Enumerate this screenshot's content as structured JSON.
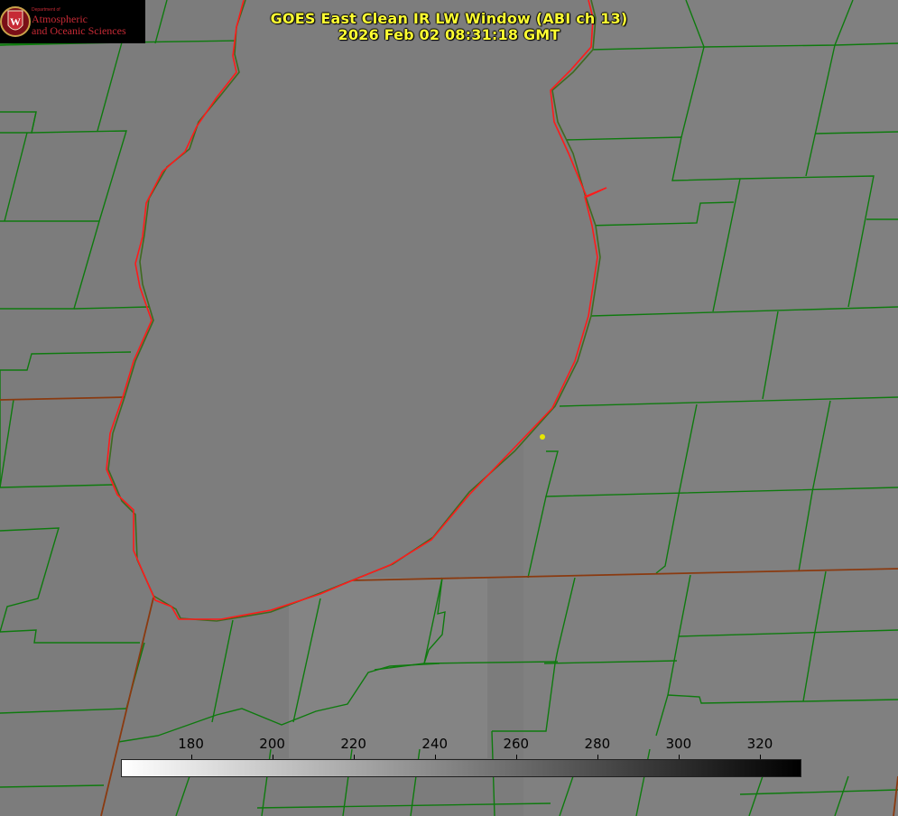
{
  "title": {
    "line1": "GOES East Clean IR LW Window (ABI ch 13)",
    "line2": "2026 Feb 02 08:31:18 GMT"
  },
  "logo": {
    "department": "Department of",
    "line1": "Atmospheric",
    "line2": "and Oceanic Sciences",
    "shield_letter": "W"
  },
  "colorbar": {
    "min": 163,
    "max": 330,
    "ticks": [
      "180",
      "200",
      "220",
      "240",
      "260",
      "280",
      "300",
      "320"
    ],
    "gradient": [
      "#ffffff",
      "#000000"
    ]
  },
  "colors": {
    "background": "#7c7c7c",
    "lake_shoreline": "#ff1a1a",
    "county_borders": "#0e7a0e",
    "state_border": "#8a3a10",
    "title_text": "#ffff33",
    "marker": "#e6e600"
  },
  "map": {
    "feature": "lake",
    "marker": "location-dot"
  }
}
